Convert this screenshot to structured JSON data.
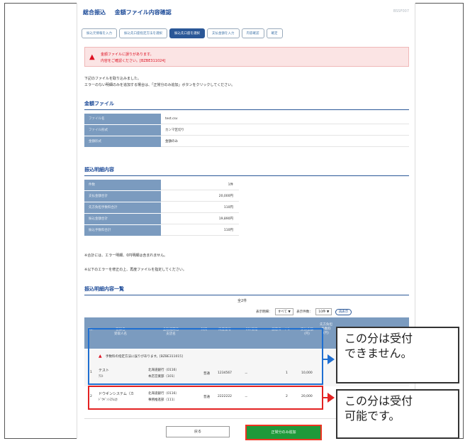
{
  "header": {
    "category": "総合振込",
    "title": "金額ファイル内容確認",
    "screen_id": "BSSF007"
  },
  "steps": [
    "振込元情報を入力",
    "振込先口座指定方法を選択",
    "振込先口座を選択",
    "支払金額を入力",
    "内容確認",
    "確定"
  ],
  "active_step": 2,
  "error": {
    "line1": "金額ファイルに誤りがあります。",
    "line2": "内容をご確認ください。[BZBE311024]"
  },
  "intro": {
    "line1": "下記のファイルを取り込みました。",
    "line2": "エラーのない明細のみを追加する場合は、「正常分のみ追加」ボタンをクリックしてください。"
  },
  "file_section": {
    "title": "金額ファイル",
    "rows": [
      {
        "label": "ファイル名",
        "value": "test.csv"
      },
      {
        "label": "ファイル形式",
        "value": "カンマ区切り"
      },
      {
        "label": "金額形式",
        "value": "金額のみ"
      }
    ]
  },
  "detail_section": {
    "title": "振込明細内容",
    "rows": [
      {
        "label": "件数",
        "value": "1件"
      },
      {
        "label": "支払金額合計",
        "value": "20,000円"
      },
      {
        "label": "先方負担手数料合計",
        "value": "110円"
      },
      {
        "label": "振込金額合計",
        "value": "19,890円"
      },
      {
        "label": "振込手数料合計",
        "value": "110円"
      }
    ],
    "note1": "※合計には、エラー明細、0円明細は含まれません。",
    "note2": "※以下のエラーを修正の上、再度ファイルを指定してください。"
  },
  "list_section": {
    "title": "振込明細内容一覧",
    "total": "全2件",
    "filter_label": "表示明細：",
    "filter_value": "すべて",
    "count_label": "表示件数：",
    "count_value": "10件",
    "redisplay": "再表示",
    "columns": [
      "No.",
      "登録名\n受取人名",
      "金融機関名\n支店名",
      "科目",
      "口座番号",
      "EDI情報",
      "顧客コード1",
      "支払金額\n(円)",
      "先方負担\n手数料\n(円)"
    ],
    "error_row_message": "手数料の指定方法に誤りがあります。[BZBE311015]",
    "rows": [
      {
        "no": "1",
        "name": "テスト",
        "kana": "ﾃｽﾄ",
        "bank": "北海道銀行（0116）",
        "branch": "本店営業部（101）",
        "type": "普通",
        "account": "1234567",
        "edi": "－",
        "code": "1",
        "amount": "10,000"
      },
      {
        "no": "2",
        "name": "ドウギンシステム（カ",
        "kana": "ﾄﾞｳｷﾞﾝｼｽﾃﾑ(ｶ",
        "bank": "北海道銀行（0116）",
        "branch": "事務推進部（111）",
        "type": "普通",
        "account": "2222222",
        "edi": "－",
        "code": "2",
        "amount": "20,000"
      }
    ]
  },
  "buttons": {
    "back": "戻る",
    "add_valid": "正常分のみ追加"
  },
  "callouts": {
    "ng": "この分は受付\nできません。",
    "ok": "この分は受付\n可能です。"
  },
  "colors": {
    "accent": "#1e4c99",
    "header_cell": "#7b9bbf",
    "error_red": "#dd1122",
    "ng_box": "#1f6fd1",
    "ok_box": "#e32222",
    "add_button": "#1e9a3a"
  }
}
